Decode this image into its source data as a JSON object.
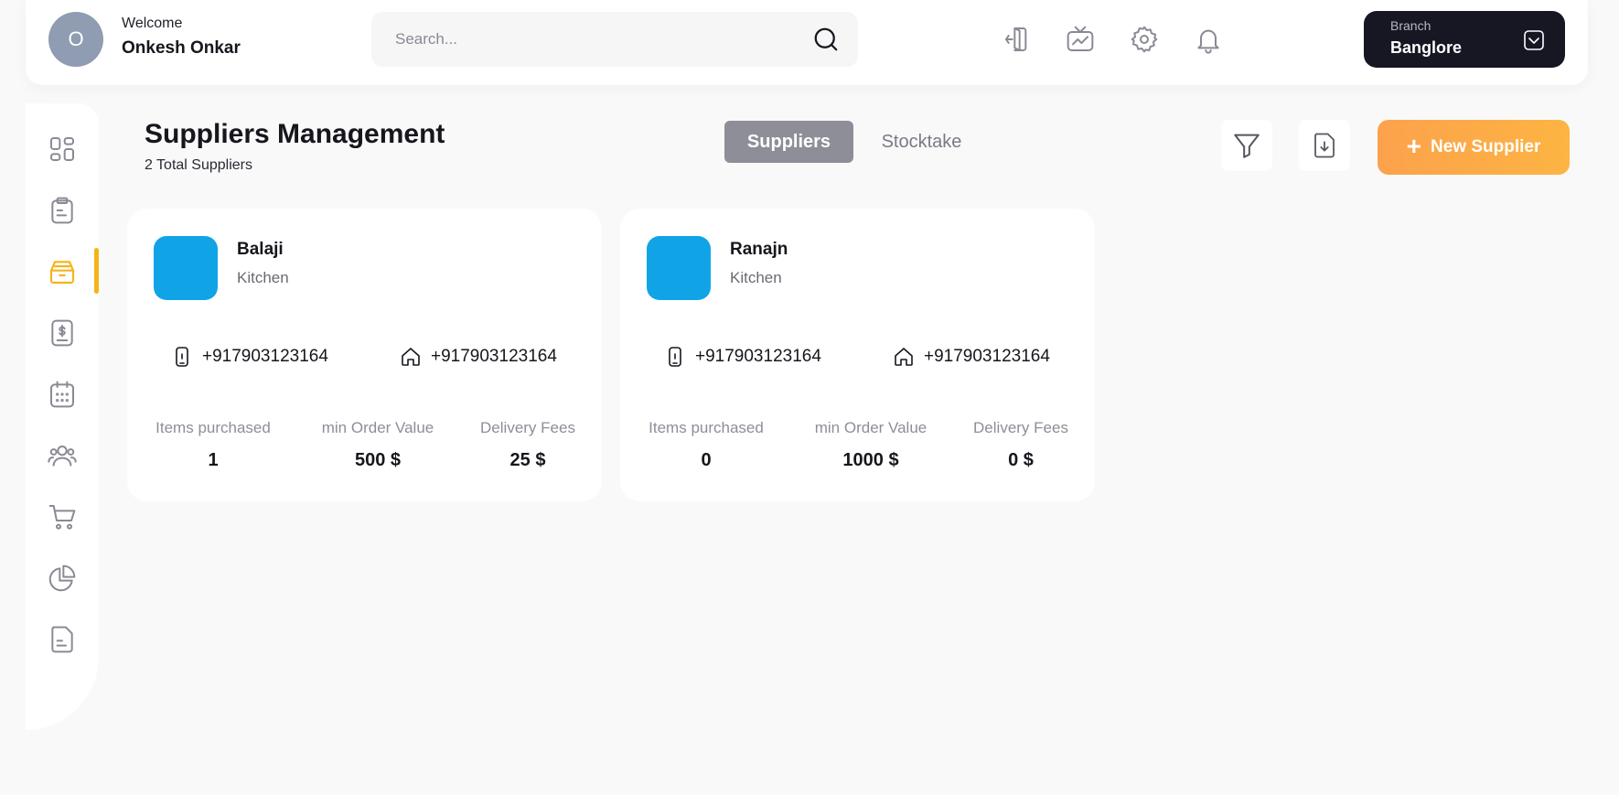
{
  "header": {
    "avatar_initial": "O",
    "welcome": "Welcome",
    "username": "Onkesh Onkar",
    "search_placeholder": "Search...",
    "icons": [
      "logout-icon",
      "analytics-tv-icon",
      "settings-icon",
      "bell-icon"
    ],
    "branch": {
      "label": "Branch",
      "value": "Banglore"
    }
  },
  "sidebar": {
    "items": [
      {
        "icon": "dashboard-icon"
      },
      {
        "icon": "clipboard-icon"
      },
      {
        "icon": "supplier-box-icon",
        "active": true
      },
      {
        "icon": "invoice-dollar-icon"
      },
      {
        "icon": "calendar-icon"
      },
      {
        "icon": "users-icon"
      },
      {
        "icon": "cart-icon"
      },
      {
        "icon": "pie-chart-icon"
      },
      {
        "icon": "document-icon"
      }
    ],
    "accent": "#f5b418"
  },
  "page": {
    "title": "Suppliers Management",
    "subtitle": "2 Total Suppliers",
    "tabs": [
      {
        "label": "Suppliers",
        "active": true
      },
      {
        "label": "Stocktake",
        "active": false
      }
    ],
    "new_button": "New Supplier",
    "new_button_plus": "+"
  },
  "suppliers": [
    {
      "name": "Balaji",
      "category": "Kitchen",
      "mobile": "+917903123164",
      "home": "+917903123164",
      "stats": [
        {
          "label": "Items purchased",
          "value": "1"
        },
        {
          "label": "min Order Value",
          "value": "500 $"
        },
        {
          "label": "Delivery Fees",
          "value": "25 $"
        }
      ]
    },
    {
      "name": "Ranajn",
      "category": "Kitchen",
      "mobile": "+917903123164",
      "home": "+917903123164",
      "stats": [
        {
          "label": "Items purchased",
          "value": "0"
        },
        {
          "label": "min Order Value",
          "value": "1000 $"
        },
        {
          "label": "Delivery Fees",
          "value": "0 $"
        }
      ]
    }
  ],
  "colors": {
    "logo_blue": "#10a4e6",
    "accent_orange": "#fca24c",
    "dark": "#171723"
  }
}
